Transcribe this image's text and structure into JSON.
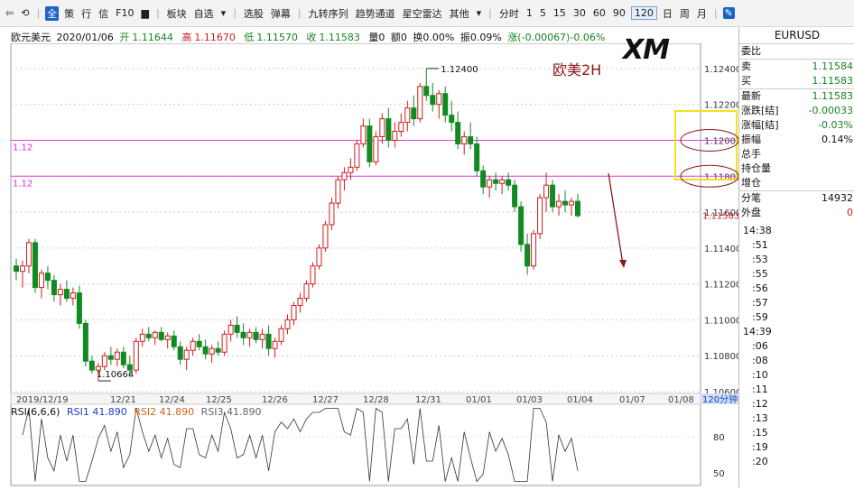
{
  "toolbar": {
    "items": [
      "全",
      "策",
      "行",
      "信",
      "F10",
      "板块",
      "自选",
      "选股",
      "弹幕",
      "九转序列",
      "趋势通道",
      "星空雷达",
      "其他",
      "分时",
      "1",
      "5",
      "15",
      "30",
      "60",
      "90",
      "120",
      "日",
      "周",
      "月"
    ],
    "active_index": 0,
    "selected_period": "120"
  },
  "info": {
    "name": "欧元美元",
    "date": "2020/01/06",
    "open_label": "开",
    "open": "1.11644",
    "high_label": "高",
    "high": "1.11670",
    "low_label": "低",
    "low": "1.11570",
    "close_label": "收",
    "close": "1.11583",
    "vol": "量0",
    "amount": "额0",
    "turnover": "换0.00%",
    "amplitude": "振0.09%",
    "change": "涨(-0.00067)-0.06%"
  },
  "overlay": {
    "watermark": "欧美2H",
    "logo": "XM",
    "hline_label_1": "1.12",
    "hline_label_2": "1.12",
    "high_annot": "1.12400",
    "low_annot": "1.10664",
    "current_price": "1.11583",
    "period_label": "120分钟"
  },
  "axes": {
    "y_ticks": [
      "1.12400",
      "1.12200",
      "1.12000",
      "1.11800",
      "1.11600",
      "1.11400",
      "1.11200",
      "1.11000",
      "1.10800",
      "1.10600"
    ],
    "x_ticks": [
      "2019/12/19",
      "12/21",
      "12/24",
      "12/25",
      "12/26",
      "12/27",
      "12/28",
      "12/31",
      "01/01",
      "01/03",
      "01/04",
      "01/07",
      "01/08"
    ],
    "rsi_ticks": [
      "80",
      "50"
    ]
  },
  "rsi": {
    "title": "RSI(6,6,6)",
    "rsi1": "RSI1 41.890",
    "rsi2": "RSI2 41.890",
    "rsi3": "RSI3 41.890"
  },
  "panel": {
    "title": "EURUSD",
    "rows": [
      {
        "label": "委比",
        "value": ""
      },
      {
        "label": "卖",
        "value": "1.11584"
      },
      {
        "label": "买",
        "value": "1.11583"
      },
      {
        "label": "最新",
        "value": "1.11583"
      },
      {
        "label": "涨跌[结]",
        "value": "-0.00033"
      },
      {
        "label": "涨幅[结]",
        "value": "-0.03%"
      },
      {
        "label": "振幅",
        "value": "0.14%"
      },
      {
        "label": "总手",
        "value": ""
      },
      {
        "label": "持仓量",
        "value": ""
      },
      {
        "label": "增仓",
        "value": ""
      },
      {
        "label": "分笔",
        "value": "14932"
      },
      {
        "label": "外盘",
        "value": "0"
      }
    ],
    "times": [
      "14:38",
      ":51",
      ":53",
      ":55",
      ":56",
      ":57",
      ":59",
      "14:39",
      ":06",
      ":08",
      ":10",
      ":11",
      ":12",
      ":13",
      ":15",
      ":19",
      ":20"
    ]
  },
  "chart_data": {
    "type": "candlestick",
    "ylim": [
      1.106,
      1.125
    ],
    "candles": [
      [
        1.113,
        1.1134,
        1.1122,
        1.1127
      ],
      [
        1.1127,
        1.1133,
        1.1118,
        1.113
      ],
      [
        1.113,
        1.1145,
        1.1126,
        1.1143
      ],
      [
        1.1143,
        1.1145,
        1.1115,
        1.1118
      ],
      [
        1.1118,
        1.1128,
        1.1112,
        1.1126
      ],
      [
        1.1126,
        1.113,
        1.1117,
        1.1122
      ],
      [
        1.1122,
        1.1125,
        1.111,
        1.1114
      ],
      [
        1.1114,
        1.112,
        1.1108,
        1.1117
      ],
      [
        1.1117,
        1.1122,
        1.111,
        1.1112
      ],
      [
        1.1112,
        1.1118,
        1.1108,
        1.1115
      ],
      [
        1.1115,
        1.1119,
        1.1095,
        1.1098
      ],
      [
        1.1098,
        1.11,
        1.1074,
        1.1077
      ],
      [
        1.1077,
        1.108,
        1.107,
        1.1072
      ],
      [
        1.1072,
        1.1076,
        1.1066,
        1.1074
      ],
      [
        1.1074,
        1.1082,
        1.1072,
        1.108
      ],
      [
        1.108,
        1.1085,
        1.1075,
        1.1078
      ],
      [
        1.1078,
        1.1084,
        1.1074,
        1.1082
      ],
      [
        1.1082,
        1.1085,
        1.1073,
        1.1075
      ],
      [
        1.1075,
        1.108,
        1.1068,
        1.1072
      ],
      [
        1.1072,
        1.109,
        1.107,
        1.1088
      ],
      [
        1.1088,
        1.1095,
        1.1085,
        1.1092
      ],
      [
        1.1092,
        1.1096,
        1.1088,
        1.109
      ],
      [
        1.109,
        1.1094,
        1.1086,
        1.1093
      ],
      [
        1.1093,
        1.1096,
        1.1088,
        1.1089
      ],
      [
        1.1089,
        1.1093,
        1.1084,
        1.1091
      ],
      [
        1.1091,
        1.1094,
        1.1083,
        1.1085
      ],
      [
        1.1085,
        1.1088,
        1.1075,
        1.1078
      ],
      [
        1.1078,
        1.1085,
        1.1072,
        1.1083
      ],
      [
        1.1083,
        1.109,
        1.108,
        1.1088
      ],
      [
        1.1088,
        1.1092,
        1.1083,
        1.1085
      ],
      [
        1.1085,
        1.1089,
        1.1078,
        1.1081
      ],
      [
        1.1081,
        1.1086,
        1.1076,
        1.1084
      ],
      [
        1.1084,
        1.1088,
        1.108,
        1.1082
      ],
      [
        1.1082,
        1.1094,
        1.108,
        1.1092
      ],
      [
        1.1092,
        1.11,
        1.1088,
        1.1097
      ],
      [
        1.1097,
        1.1102,
        1.109,
        1.1093
      ],
      [
        1.1093,
        1.1098,
        1.1086,
        1.109
      ],
      [
        1.109,
        1.1095,
        1.1085,
        1.1093
      ],
      [
        1.1093,
        1.1096,
        1.1087,
        1.1089
      ],
      [
        1.1089,
        1.1095,
        1.1084,
        1.1092
      ],
      [
        1.1092,
        1.1097,
        1.108,
        1.1084
      ],
      [
        1.1084,
        1.109,
        1.1079,
        1.1088
      ],
      [
        1.1088,
        1.1097,
        1.1086,
        1.1095
      ],
      [
        1.1095,
        1.1103,
        1.1092,
        1.11
      ],
      [
        1.11,
        1.111,
        1.1097,
        1.1108
      ],
      [
        1.1108,
        1.1115,
        1.1104,
        1.1112
      ],
      [
        1.1112,
        1.1122,
        1.111,
        1.112
      ],
      [
        1.112,
        1.1132,
        1.1118,
        1.113
      ],
      [
        1.113,
        1.1142,
        1.1128,
        1.114
      ],
      [
        1.114,
        1.1155,
        1.1138,
        1.1153
      ],
      [
        1.1153,
        1.1168,
        1.115,
        1.1165
      ],
      [
        1.1165,
        1.118,
        1.1162,
        1.1178
      ],
      [
        1.1178,
        1.1185,
        1.1172,
        1.1182
      ],
      [
        1.1182,
        1.119,
        1.1178,
        1.1185
      ],
      [
        1.1185,
        1.12,
        1.1183,
        1.1198
      ],
      [
        1.1198,
        1.1212,
        1.1196,
        1.1208
      ],
      [
        1.1208,
        1.1212,
        1.1185,
        1.1188
      ],
      [
        1.1188,
        1.1205,
        1.1186,
        1.1202
      ],
      [
        1.1202,
        1.1215,
        1.1198,
        1.1212
      ],
      [
        1.1212,
        1.1218,
        1.1196,
        1.12
      ],
      [
        1.12,
        1.121,
        1.1196,
        1.1205
      ],
      [
        1.1205,
        1.1215,
        1.1202,
        1.121
      ],
      [
        1.121,
        1.1222,
        1.1205,
        1.1218
      ],
      [
        1.1218,
        1.1225,
        1.1208,
        1.1212
      ],
      [
        1.1212,
        1.1232,
        1.121,
        1.123
      ],
      [
        1.123,
        1.124,
        1.1222,
        1.1225
      ],
      [
        1.1225,
        1.1232,
        1.1216,
        1.122
      ],
      [
        1.122,
        1.1228,
        1.1212,
        1.1226
      ],
      [
        1.1226,
        1.123,
        1.121,
        1.1214
      ],
      [
        1.1214,
        1.1222,
        1.1205,
        1.121
      ],
      [
        1.121,
        1.1216,
        1.1195,
        1.1198
      ],
      [
        1.1198,
        1.1205,
        1.1192,
        1.1202
      ],
      [
        1.1202,
        1.121,
        1.1195,
        1.1198
      ],
      [
        1.1198,
        1.1202,
        1.118,
        1.1183
      ],
      [
        1.1183,
        1.1186,
        1.117,
        1.1174
      ],
      [
        1.1174,
        1.118,
        1.1168,
        1.1178
      ],
      [
        1.1178,
        1.1182,
        1.1172,
        1.1176
      ],
      [
        1.1176,
        1.118,
        1.117,
        1.1178
      ],
      [
        1.1178,
        1.1182,
        1.1172,
        1.1175
      ],
      [
        1.1175,
        1.1178,
        1.116,
        1.1163
      ],
      [
        1.1163,
        1.1166,
        1.1138,
        1.1142
      ],
      [
        1.1142,
        1.1148,
        1.1125,
        1.113
      ],
      [
        1.113,
        1.115,
        1.1128,
        1.1148
      ],
      [
        1.1148,
        1.117,
        1.1145,
        1.1168
      ],
      [
        1.1168,
        1.1182,
        1.116,
        1.1175
      ],
      [
        1.1175,
        1.1178,
        1.116,
        1.1163
      ],
      [
        1.1163,
        1.117,
        1.1158,
        1.1166
      ],
      [
        1.1166,
        1.1172,
        1.116,
        1.1164
      ],
      [
        1.1164,
        1.1168,
        1.1158,
        1.1166
      ],
      [
        1.1166,
        1.117,
        1.1157,
        1.1158
      ]
    ]
  }
}
